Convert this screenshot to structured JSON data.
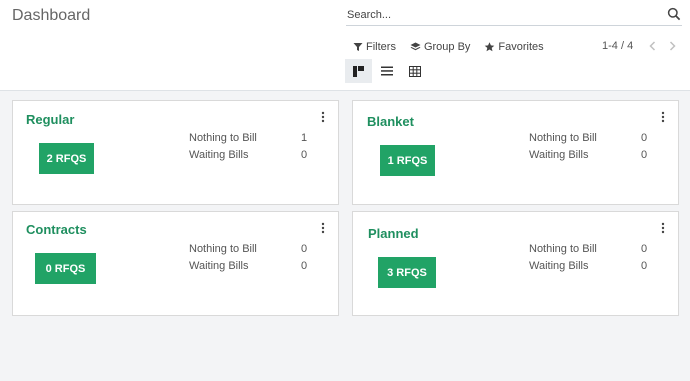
{
  "header": {
    "title": "Dashboard",
    "search_placeholder": "Search...",
    "filters_label": "Filters",
    "group_by_label": "Group By",
    "favorites_label": "Favorites",
    "pager": "1-4 / 4"
  },
  "views": [
    "kanban-icon",
    "list-icon",
    "pivot-icon"
  ],
  "cards": [
    {
      "title": "Regular",
      "rfq_label": "2 RFQS",
      "stats": [
        {
          "label": "Nothing to Bill",
          "value": "1"
        },
        {
          "label": "Waiting Bills",
          "value": "0"
        }
      ]
    },
    {
      "title": "Blanket",
      "rfq_label": "1 RFQS",
      "stats": [
        {
          "label": "Nothing to Bill",
          "value": "0"
        },
        {
          "label": "Waiting Bills",
          "value": "0"
        }
      ]
    },
    {
      "title": "Contracts",
      "rfq_label": "0 RFQS",
      "stats": [
        {
          "label": "Nothing to Bill",
          "value": "0"
        },
        {
          "label": "Waiting Bills",
          "value": "0"
        }
      ]
    },
    {
      "title": "Planned",
      "rfq_label": "3 RFQS",
      "stats": [
        {
          "label": "Nothing to Bill",
          "value": "0"
        },
        {
          "label": "Waiting Bills",
          "value": "0"
        }
      ]
    }
  ],
  "colors": {
    "accent": "#21a366",
    "title_green": "#1f8f5f",
    "background": "#f3f4f6"
  }
}
